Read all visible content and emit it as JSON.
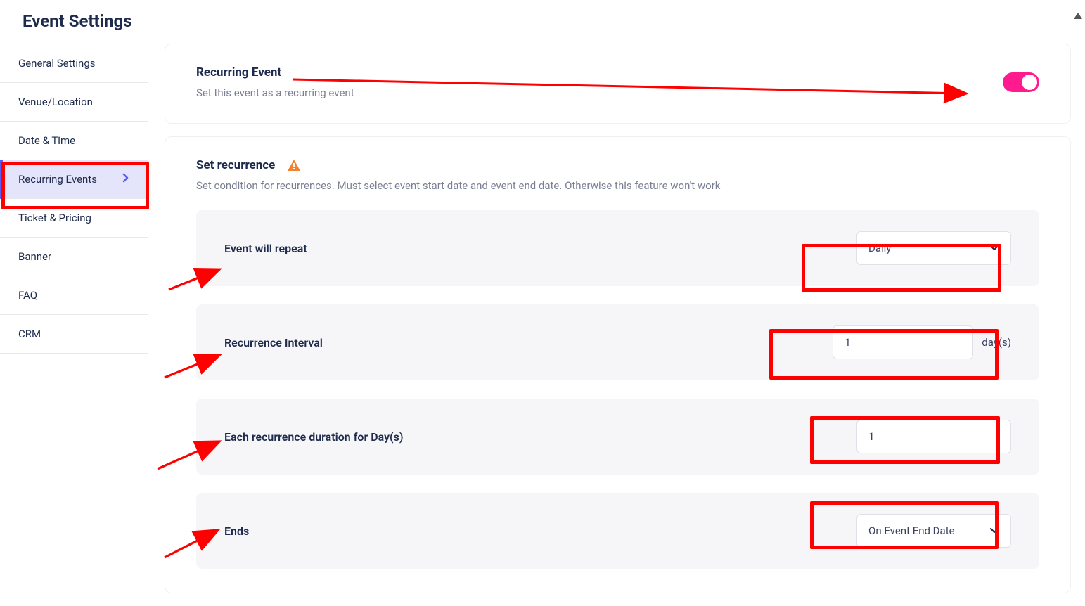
{
  "page_title": "Event Settings",
  "sidebar": {
    "items": [
      {
        "label": "General Settings"
      },
      {
        "label": "Venue/Location"
      },
      {
        "label": "Date & Time"
      },
      {
        "label": "Recurring Events"
      },
      {
        "label": "Ticket & Pricing"
      },
      {
        "label": "Banner"
      },
      {
        "label": "FAQ"
      },
      {
        "label": "CRM"
      }
    ]
  },
  "recurring_card": {
    "title": "Recurring Event",
    "subtitle": "Set this event as a recurring event"
  },
  "recurrence_section": {
    "title": "Set recurrence",
    "subtitle": "Set condition for recurrences. Must select event start date and event end date. Otherwise this feature won't work",
    "rows": {
      "repeat_label": "Event will repeat",
      "repeat_value": "Daily",
      "interval_label": "Recurrence Interval",
      "interval_value": "1",
      "interval_suffix": "day(s)",
      "duration_label": "Each recurrence duration for Day(s)",
      "duration_value": "1",
      "ends_label": "Ends",
      "ends_value": "On Event End Date"
    }
  }
}
